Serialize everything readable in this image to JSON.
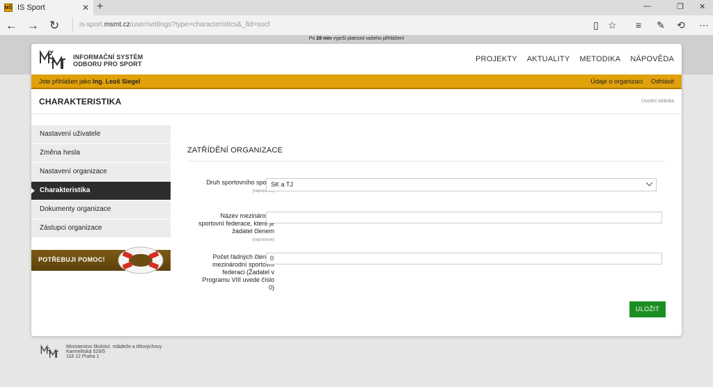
{
  "browser": {
    "tab_title": "IS Sport",
    "favicon_text": "MŠ",
    "url_prefix": "is-sport.",
    "url_domain": "msmt.cz",
    "url_path": "/user/settings?type=characteristics&_fid=socf"
  },
  "session": {
    "prefix": "Po ",
    "minutes": "28 min",
    "suffix": " vyprší platnost vašeho přihlášení"
  },
  "header": {
    "logo_line1": "INFORMAČNÍ SYSTÉM",
    "logo_line2": "ODBORU PRO SPORT",
    "nav": [
      "PROJEKTY",
      "AKTUALITY",
      "METODIKA",
      "NÁPOVĚDA"
    ]
  },
  "userbar": {
    "logged_in_prefix": "Jste přihlášen jako ",
    "user_name": "Ing. Leoš Siegel",
    "org_link": "Údaje o organizaci",
    "logout": "Odhlásit"
  },
  "page": {
    "title": "CHARAKTERISTIKA",
    "breadcrumb": "Úvodní stránka"
  },
  "sidebar": {
    "items": [
      {
        "label": "Nastavení uživatele"
      },
      {
        "label": "Změna hesla"
      },
      {
        "label": "Nastavení organizace"
      },
      {
        "label": "Charakteristika"
      },
      {
        "label": "Dokumenty organizace"
      },
      {
        "label": "Zástupci organizace"
      }
    ],
    "active_index": 3,
    "help_banner": "POTŘEBUJI POMOC!"
  },
  "form": {
    "section_title": "ZATŘÍDĚNÍ ORGANIZACE",
    "fields": [
      {
        "label": "Druh sportovního spolku",
        "optional": "(nepovinné)",
        "value": "SK a TJ"
      },
      {
        "label": "Název mezinárodní sportovní federace, které je žadatel členem",
        "optional": "(nepovinné)",
        "value": ""
      },
      {
        "label": "Počet řádných členů v mezinárodní sportovní federaci (Žadatel v Programu VIII uvede číslo 0)",
        "value": "0"
      }
    ],
    "save_label": "ULOŽIT"
  },
  "footer": {
    "line1": "Ministerstvo školství, mládeže a tělovýchovy",
    "line2": "Karmelitská 529/5",
    "line3": "118 12 Praha 1"
  },
  "colors": {
    "accent": "#e1a10a",
    "active_nav": "#2d2d2d",
    "save_button": "#1b8e22"
  }
}
